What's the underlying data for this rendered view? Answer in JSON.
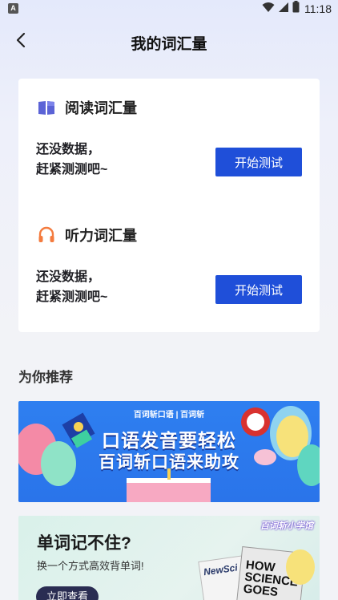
{
  "status_bar": {
    "left_badge": "A",
    "time": "11:18"
  },
  "header": {
    "title": "我的词汇量"
  },
  "vocab": {
    "reading": {
      "title": "阅读词汇量",
      "empty_line1": "还没数据，",
      "empty_line2": "赶紧测测吧~",
      "button": "开始测试"
    },
    "listening": {
      "title": "听力词汇量",
      "empty_line1": "还没数据，",
      "empty_line2": "赶紧测测吧~",
      "button": "开始测试"
    }
  },
  "recommend": {
    "title": "为你推荐",
    "banner1": {
      "logos": "百词斩口语 | 百词斩",
      "line1": "口语发音要轻松",
      "line2": "百词斩口语来助攻"
    },
    "banner2": {
      "title": "单词记不住?",
      "subtitle": "换一个方式高效背单词!",
      "button": "立即查看",
      "brand": "百词斩小学馆",
      "book1": "NewSci",
      "book2_line1": "HOW",
      "book2_line2": "SCIENCE",
      "book2_line3": "GOES"
    }
  },
  "colors": {
    "accent": "#1f4fd9",
    "reading_icon": "#5b63d6",
    "listening_icon": "#f47b3e"
  }
}
